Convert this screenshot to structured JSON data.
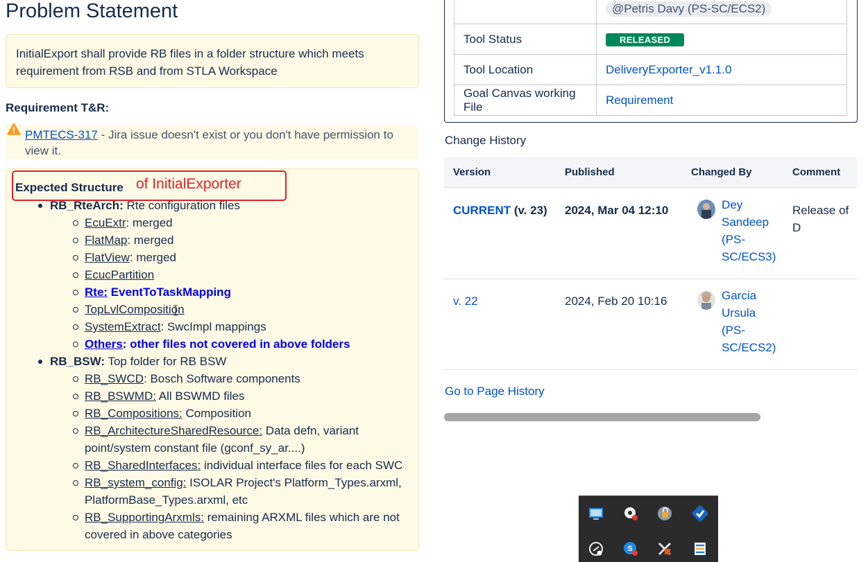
{
  "problem": {
    "title": "Problem Statement",
    "text": "InitialExport shall provide RB files in a folder structure which meets requirement from RSB and from STLA Workspace"
  },
  "requirement": {
    "heading": "Requirement T&R:",
    "jira_key": "PMTECS-317",
    "jira_msg": " - Jira issue doesn't exist or you don't have permission to view it."
  },
  "expected": {
    "heading": "Expected Structure",
    "annotation": "of InitialExporter",
    "groups": [
      {
        "name": "RB_RteArch:",
        "desc": " Rte configuration files",
        "items": [
          {
            "name": "EcuExtr",
            "desc": ": merged"
          },
          {
            "name": "FlatMap",
            "desc": ": merged"
          },
          {
            "name": "FlatView",
            "desc": ": merged"
          },
          {
            "name": "EcucPartition",
            "desc": ""
          },
          {
            "name": "Rte:",
            "desc": " EventToTaskMapping"
          },
          {
            "name": "TopLvlComposition",
            "desc": ""
          },
          {
            "name": "SystemExtract",
            "desc": ": SwcImpl mappings"
          },
          {
            "name": "Others",
            "desc": ": other files not covered in above folders"
          }
        ]
      },
      {
        "name": "RB_BSW:",
        "desc": " Top folder for RB BSW",
        "items": [
          {
            "name": "RB_SWCD",
            "desc": ": Bosch Software components"
          },
          {
            "name": "RB_BSWMD:",
            "desc": " All BSWMD files"
          },
          {
            "name": "RB_Compositions:",
            "desc": " Composition"
          },
          {
            "name": "RB_ArchitectureSharedResource:",
            "desc": " Data defn, variant",
            "desc2": "point/system constant file (gconf_sy_ar....)"
          },
          {
            "name": "RB_SharedInterfaces:",
            "desc": " individual interface files for each SWC"
          },
          {
            "name": "RB_system_config:",
            "desc": " ISOLAR Project's Platform_Types.arxml,",
            "desc2": "PlatformBase_Types.arxml, etc"
          },
          {
            "name": "RB_SupportingArxmls:",
            "desc": " remaining ARXML files which are not",
            "desc2": "covered in above categories"
          }
        ]
      }
    ]
  },
  "info": {
    "owner_mention": "@Petris Davy (PS-SC/ECS2)",
    "rows": [
      {
        "key": "Tool Status",
        "value": "RELEASED"
      },
      {
        "key": "Tool Location",
        "value": "DeliveryExporter_v1.1.0"
      },
      {
        "key": "Goal Canvas working File",
        "value": "Requirement"
      }
    ]
  },
  "history": {
    "title": "Change History",
    "columns": [
      "Version",
      "Published",
      "Changed By",
      "Comment"
    ],
    "rows": [
      {
        "version": "CURRENT",
        "version_suffix": " (v. 23)",
        "published": "2024, Mar 04 12:10",
        "by": [
          "Dey",
          "Sandeep",
          "(PS-",
          "SC/ECS3)"
        ],
        "comment": "Release of D"
      },
      {
        "version": "v. 22",
        "version_suffix": "",
        "published": "2024, Feb 20 10:16",
        "by": [
          "Garcia",
          "Ursula",
          "(PS-",
          "SC/ECS2)"
        ],
        "comment": ""
      }
    ],
    "goto": "Go to Page History"
  },
  "colors": {
    "accent": "#0052cc",
    "released": "#00875a",
    "annotation": "#e0202a",
    "panel": "#fffae6"
  },
  "tray_icons": [
    "network-icon",
    "settings-icon",
    "lock-icon",
    "check-shield-icon",
    "speed-icon",
    "skype-icon",
    "tools-icon",
    "notes-icon"
  ]
}
